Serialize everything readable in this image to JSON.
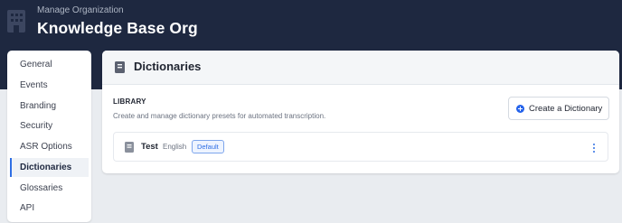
{
  "header": {
    "subtitle": "Manage Organization",
    "title": "Knowledge Base Org"
  },
  "sidebar": {
    "items": [
      {
        "label": "General"
      },
      {
        "label": "Events"
      },
      {
        "label": "Branding"
      },
      {
        "label": "Security"
      },
      {
        "label": "ASR Options"
      },
      {
        "label": "Dictionaries",
        "active": true
      },
      {
        "label": "Glossaries"
      },
      {
        "label": "API"
      }
    ]
  },
  "main": {
    "title": "Dictionaries",
    "library_label": "LIBRARY",
    "library_description": "Create and manage dictionary presets for automated transcription.",
    "create_button_label": "Create a Dictionary",
    "dictionaries": [
      {
        "name": "Test",
        "language": "English",
        "badge": "Default"
      }
    ]
  },
  "colors": {
    "header_bg": "#1e2840",
    "accent": "#2f6fe4",
    "page_bg": "#e9ecf0"
  }
}
